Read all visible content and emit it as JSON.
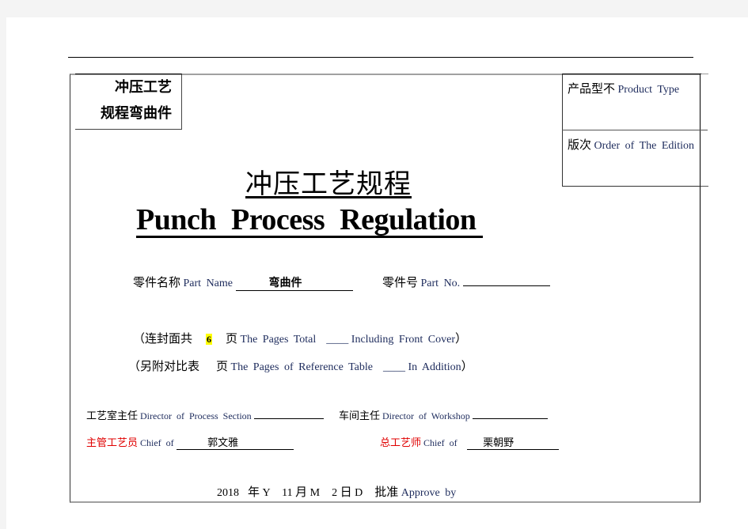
{
  "header_box": {
    "line1": "冲压工艺",
    "line2": "规程弯曲件"
  },
  "right_box": {
    "product_type_zh": "产品型不",
    "product_type_en": "Product Type",
    "edition_zh": "版次",
    "edition_en": "Order of The Edition"
  },
  "title": {
    "zh": "冲压工艺规程",
    "en": "Punch Process Regulation"
  },
  "part": {
    "name_label_zh": "零件名称",
    "name_label_en": "Part Name",
    "name_value": "弯曲件",
    "no_label_zh": "零件号",
    "no_label_en": "Part No.",
    "no_value": ""
  },
  "pages": {
    "total_prefix_zh": "（连封面共",
    "total_count": "6",
    "total_page_zh": "页",
    "total_en": "The Pages Total",
    "total_blank": "____",
    "total_suffix_en": "Including Front Cover",
    "total_close": "）",
    "ref_prefix_zh": "（另附对比表",
    "ref_page_zh": "页",
    "ref_en": "The Pages of Reference Table",
    "ref_blank": "____",
    "ref_suffix_en": "In Addition",
    "ref_close": "）"
  },
  "signatures": {
    "process_director_zh": "工艺室主任",
    "process_director_en": "Director of Process Section",
    "process_director_value": "",
    "workshop_director_zh": "车间主任",
    "workshop_director_en": "Director of Workshop",
    "workshop_director_value": "",
    "chief_zh": "主管工艺员",
    "chief_en": "Chief of",
    "chief_value": "郭文雅",
    "general_chief_zh": "总工艺师",
    "general_chief_en": "Chief of",
    "general_chief_value": "栗朝野"
  },
  "date": {
    "year": "2018",
    "year_zh": "年",
    "year_en": "Y",
    "month": "11",
    "month_zh": "月",
    "month_en": "M",
    "day": "2",
    "day_zh": "日",
    "day_en": "D",
    "approve_zh": "批准",
    "approve_en": "Approve by"
  },
  "colors": {
    "highlight": "#ffff00",
    "red_label": "#e00000",
    "english_text": "#1d2b5c",
    "background": "#f4f4f4"
  }
}
